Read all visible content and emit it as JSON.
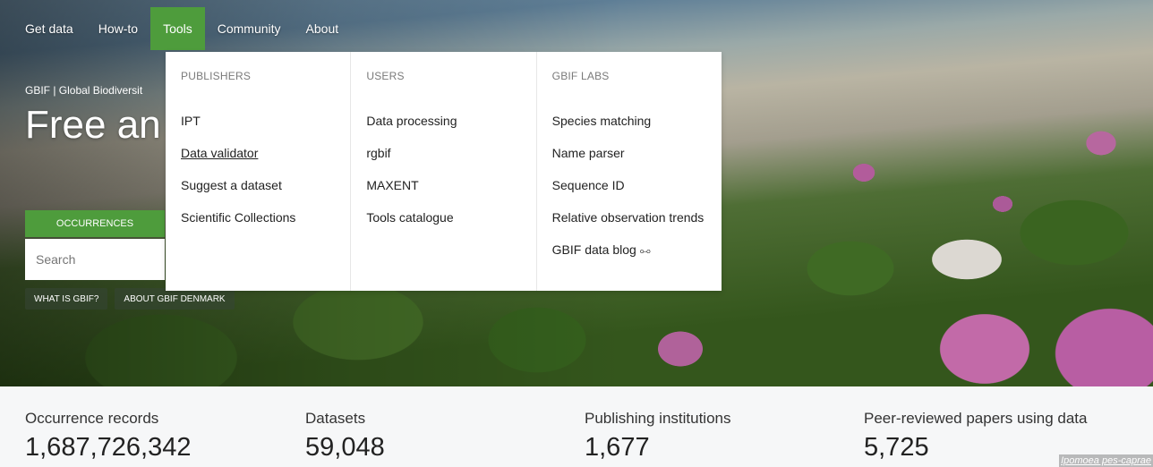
{
  "nav": {
    "items": [
      {
        "label": "Get data"
      },
      {
        "label": "How-to"
      },
      {
        "label": "Tools",
        "active": true
      },
      {
        "label": "Community"
      },
      {
        "label": "About"
      }
    ]
  },
  "hero": {
    "subtitle": "GBIF | Global Biodiversit",
    "title": "Free an biodiver",
    "occurrences_tab": "OCCURRENCES",
    "search_placeholder": "Search",
    "links": [
      "WHAT IS GBIF?",
      "ABOUT GBIF DENMARK"
    ],
    "photo_caption": "Ipomoea pes-caprae"
  },
  "dropdown": {
    "columns": [
      {
        "heading": "PUBLISHERS",
        "links": [
          "IPT",
          "Data validator",
          "Suggest a dataset",
          "Scientific Collections"
        ]
      },
      {
        "heading": "USERS",
        "links": [
          "Data processing",
          "rgbif",
          "MAXENT",
          "Tools catalogue"
        ]
      },
      {
        "heading": "GBIF LABS",
        "links": [
          "Species matching",
          "Name parser",
          "Sequence ID",
          "Relative observation trends",
          "GBIF data blog"
        ]
      }
    ]
  },
  "stats": [
    {
      "label": "Occurrence records",
      "value": "1,687,726,342"
    },
    {
      "label": "Datasets",
      "value": "59,048"
    },
    {
      "label": "Publishing institutions",
      "value": "1,677"
    },
    {
      "label": "Peer-reviewed papers using data",
      "value": "5,725"
    }
  ],
  "colors": {
    "accent": "#4e9c3c",
    "dropdown_bg": "#ffffff",
    "stats_bg": "#f6f7f8"
  },
  "icons": {
    "external_link": "link-icon"
  }
}
